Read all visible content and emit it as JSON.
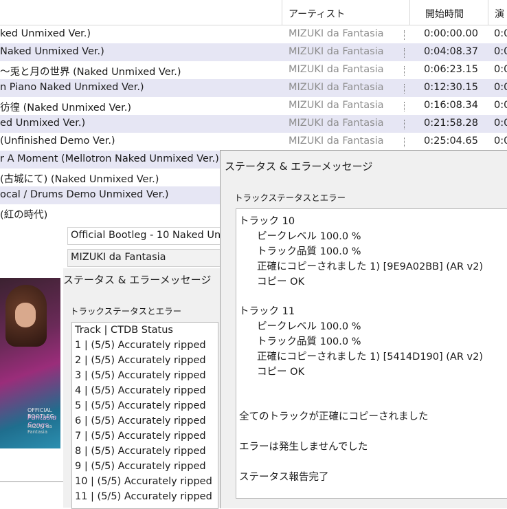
{
  "header": {
    "artist": "アーティスト",
    "start_time": "開始時間",
    "extra": "演"
  },
  "tracks": [
    {
      "title": "ked Unmixed Ver.)",
      "artist": "MIZUKI da Fantasia",
      "start": "0:00:00.00",
      "pre": "0:0"
    },
    {
      "title": "Naked Unmixed Ver.)",
      "artist": "MIZUKI da Fantasia",
      "start": "0:04:08.37",
      "pre": "0:0"
    },
    {
      "title": "〜兎と月の世界 (Naked Unmixed Ver.)",
      "artist": "MIZUKI da Fantasia",
      "start": "0:06:23.15",
      "pre": "0:0"
    },
    {
      "title": "n Piano Naked Unmixed Ver.)",
      "artist": "MIZUKI da Fantasia",
      "start": "0:12:30.15",
      "pre": "0:0"
    },
    {
      "title": "彷徨 (Naked Unmixed Ver.)",
      "artist": "MIZUKI da Fantasia",
      "start": "0:16:08.34",
      "pre": "0:0"
    },
    {
      "title": "ed Unmixed Ver.)",
      "artist": "MIZUKI da Fantasia",
      "start": "0:21:58.28",
      "pre": "0:0"
    },
    {
      "title": " (Unfinished Demo Ver.)",
      "artist": "MIZUKI da Fantasia",
      "start": "0:25:04.65",
      "pre": "0:0"
    },
    {
      "title": "r A Moment (Mellotron Naked Unmixed Ver.)",
      "artist": "",
      "start": "",
      "pre": ""
    },
    {
      "title": "(古城にて) (Naked Unmixed Ver.)",
      "artist": "",
      "start": "",
      "pre": ""
    },
    {
      "title": "ocal / Drums Demo Unmixed Ver.)",
      "artist": "",
      "start": "",
      "pre": ""
    },
    {
      "title": " (紅の時代)",
      "artist": "",
      "start": "",
      "pre": ""
    }
  ],
  "album": {
    "title_field": "Official Bootleg - 10 Naked Un",
    "artist_field": "MIZUKI da Fantasia",
    "cover_text1": "OFFICIAL BOOTLEG",
    "cover_text2": "Fantasia Songs",
    "cover_text3": "MIZUKI da Fantasia"
  },
  "status1": {
    "title": "ステータス & エラーメッセージ",
    "group": "トラックステータスとエラー",
    "lines": [
      "Track | CTDB Status",
      "  1   | (5/5) Accurately ripped",
      "  2   | (5/5) Accurately ripped",
      "  3   | (5/5) Accurately ripped",
      "  4   | (5/5) Accurately ripped",
      "  5   | (5/5) Accurately ripped",
      "  6   | (5/5) Accurately ripped",
      "  7   | (5/5) Accurately ripped",
      "  8   | (5/5) Accurately ripped",
      "  9   | (5/5) Accurately ripped",
      " 10   | (5/5) Accurately ripped",
      " 11   | (5/5) Accurately ripped"
    ]
  },
  "status2": {
    "title": "ステータス & エラーメッセージ",
    "group": "トラックステータスとエラー",
    "lines": [
      "トラック 10",
      "ピークレベル 100.0 %",
      "トラック品質 100.0 %",
      "正確にコピーされました 1)  [9E9A02BB]  (AR v2)",
      "コピー OK",
      "トラック 11",
      "ピークレベル 100.0 %",
      "トラック品質 100.0 %",
      "正確にコピーされました 1)  [5414D190]  (AR v2)",
      "コピー OK",
      "全てのトラックが正確にコピーされました",
      "エラーは発生しませんでした",
      "ステータス報告完了"
    ]
  }
}
